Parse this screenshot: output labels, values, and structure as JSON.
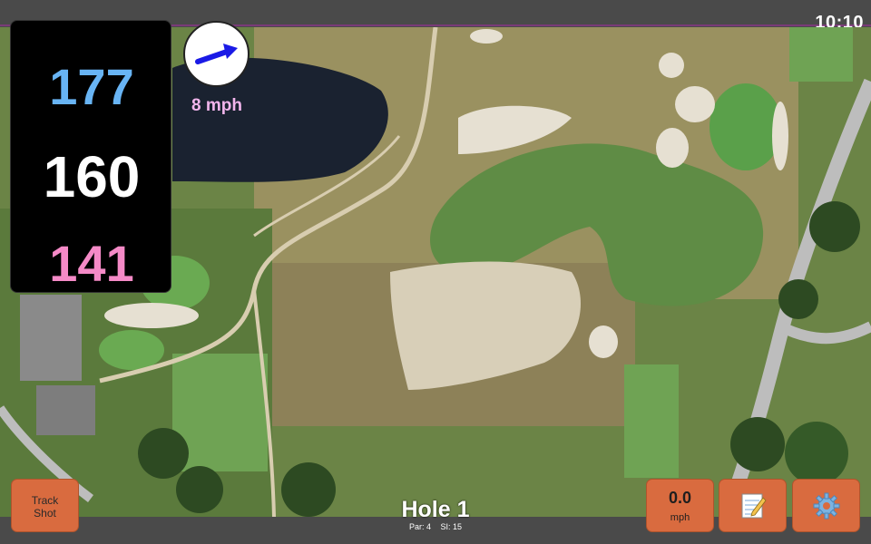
{
  "status_bar": {
    "time": "10:10"
  },
  "yardages": {
    "back": "177",
    "center": "160",
    "front": "141"
  },
  "wind": {
    "speed": "8 mph",
    "direction_icon": "arrow-right-icon"
  },
  "buttons": {
    "track_shot_line1": "Track",
    "track_shot_line2": "Shot",
    "speed_value": "0.0",
    "speed_unit": "mph",
    "notes_icon": "notepad-icon",
    "settings_icon": "gear-icon"
  },
  "hole": {
    "title": "Hole 1",
    "par": "Par: 4",
    "stroke_index": "SI: 15"
  },
  "colors": {
    "back_yardage": "#68b4f4",
    "center_yardage": "#ffffff",
    "front_yardage": "#f58ac7",
    "button": "#d96b3f",
    "wind_text": "#f2b5ec",
    "arrow": "#1a1ae6"
  }
}
